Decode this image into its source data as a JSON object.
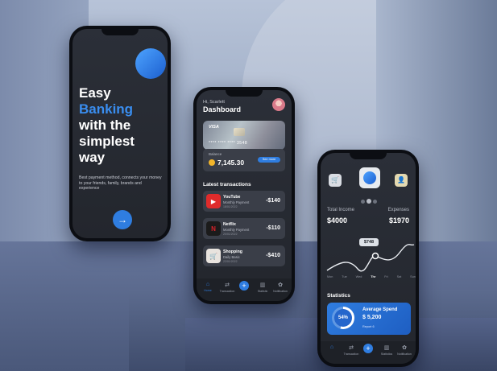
{
  "phone1": {
    "hero_line1": "Easy",
    "hero_line2": "Banking",
    "hero_line3": "with the",
    "hero_line4": "simplest",
    "hero_line5": "way",
    "subtitle": "Best payment method, connects your money to your friends, family, brands and experience",
    "next_icon": "→"
  },
  "phone2": {
    "greeting": "Hi, Scarlett",
    "title": "Dashboard",
    "card": {
      "brand": "VISA",
      "number": "****   ****   ****   3548"
    },
    "balance": {
      "label": "Balance",
      "value": "7,145.30",
      "see_more": "See more"
    },
    "transactions_title": "Latest transactions",
    "transactions": [
      {
        "icon": "▶",
        "name": "YouTube",
        "sub": "Monthly Payment",
        "date": "18/01/2022",
        "amount": "-$140",
        "color": "#e02b2b"
      },
      {
        "icon": "N",
        "name": "Netflix",
        "sub": "Monthly Payment",
        "date": "20/01/2022",
        "amount": "-$110",
        "color": "#d8222a"
      },
      {
        "icon": "🛒",
        "name": "Shopping",
        "sub": "Daily Basic",
        "date": "22/01/2022",
        "amount": "-$410",
        "color": "#e8e3de"
      }
    ],
    "nav": [
      {
        "icon": "⌂",
        "label": "Home"
      },
      {
        "icon": "⇄",
        "label": "Transaction"
      },
      {
        "icon": "+",
        "label": ""
      },
      {
        "icon": "▥",
        "label": "Statistic"
      },
      {
        "icon": "✿",
        "label": "Notification"
      }
    ]
  },
  "phone3": {
    "total_income_label": "Total Income",
    "total_income": "$4000",
    "expenses_label": "Expenses",
    "expenses": "$1970",
    "tooltip": "$748",
    "chart_days": [
      "Mon",
      "Tue",
      "Wed",
      "Thr",
      "Fri",
      "Sat",
      "Sun"
    ],
    "statistics_title": "Statistics",
    "avg_label": "Average Spend",
    "avg_value": "$ 5,200",
    "percent": "54%",
    "report": "Report 6",
    "nav": [
      {
        "icon": "⌂",
        "label": ""
      },
      {
        "icon": "⇄",
        "label": "Transaction"
      },
      {
        "icon": "+",
        "label": ""
      },
      {
        "icon": "▥",
        "label": "Statistics"
      },
      {
        "icon": "✿",
        "label": "Notification"
      }
    ]
  },
  "colors": {
    "accent": "#2f7de0",
    "screen_bg": "#2b2f38"
  }
}
